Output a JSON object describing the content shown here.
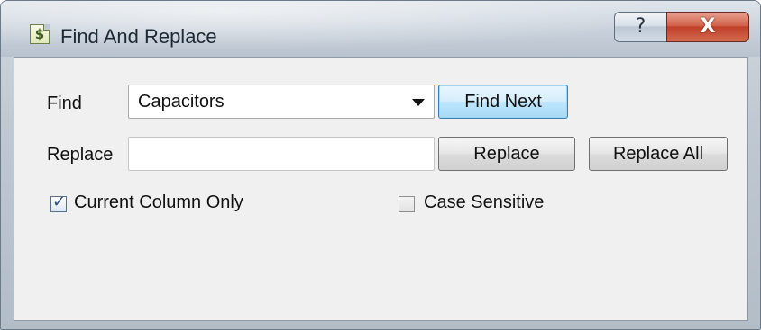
{
  "window": {
    "title": "Find And Replace",
    "app_icon_glyph": "$",
    "app_icon_name": "dollar-document-icon",
    "help_glyph": "?",
    "close_glyph": "X"
  },
  "form": {
    "find_label": "Find",
    "find_value": "Capacitors",
    "replace_label": "Replace",
    "replace_value": "",
    "find_next_label": "Find Next",
    "replace_button_label": "Replace",
    "replace_all_label": "Replace All",
    "current_column_only_label": "Current Column Only",
    "current_column_only_checked": true,
    "case_sensitive_label": "Case Sensitive",
    "case_sensitive_checked": false
  },
  "colors": {
    "default_button_accent": "#bee6fd",
    "close_button": "#c0402a"
  }
}
